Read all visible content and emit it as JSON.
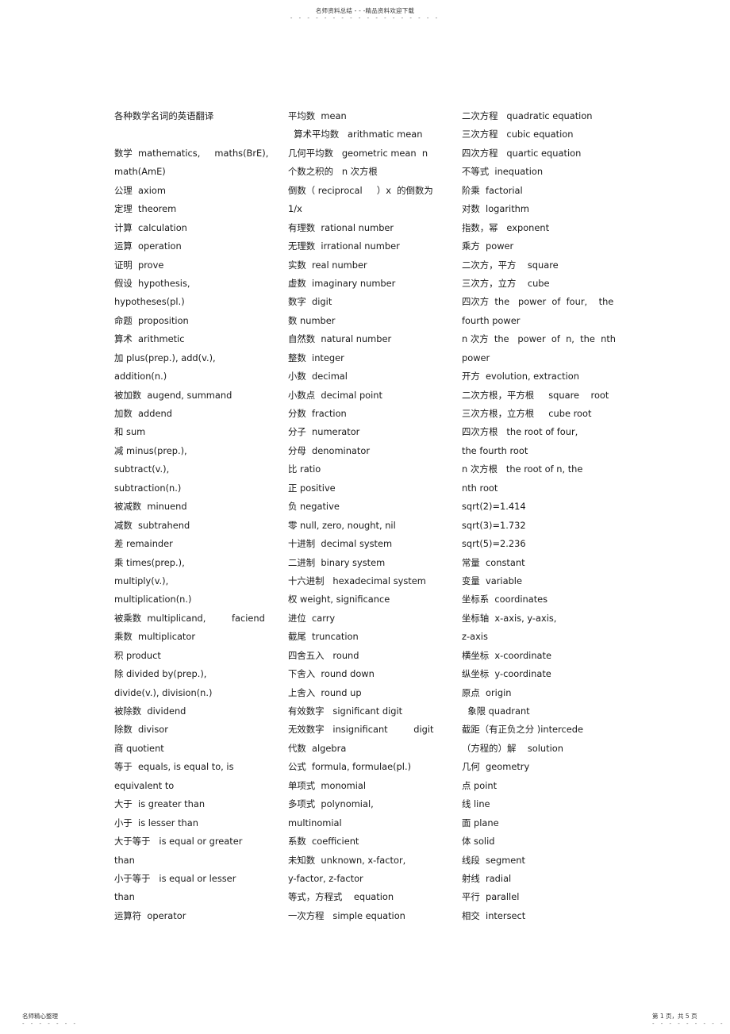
{
  "header": {
    "text": "名师资料总结 - - -精品资料欢迎下载",
    "dots": "- - - - - - - - - - - - - - - - - -"
  },
  "footer": {
    "left": "名师精心整理",
    "left_dots": "- - - - - - -",
    "right": "第 1 页，共 5 页",
    "right_dots": "- - - - - - - - -"
  },
  "columns": [
    {
      "lines": [
        "各种数学名词的英语翻译",
        "",
        "数学  mathematics,     maths(BrE),",
        "math(AmE)",
        "公理  axiom",
        "定理  theorem",
        "计算  calculation",
        "运算  operation",
        "证明  prove",
        "假设  hypothesis,",
        "hypotheses(pl.)",
        "命题  proposition",
        "算术  arithmetic",
        "加 plus(prep.), add(v.),",
        "addition(n.)",
        "被加数  augend, summand",
        "加数  addend",
        "和 sum",
        "减 minus(prep.),",
        "subtract(v.),",
        "subtraction(n.)",
        "被减数  minuend",
        "减数  subtrahend",
        "差 remainder",
        "乘 times(prep.),",
        "multiply(v.),",
        "multiplication(n.)",
        "被乘数  multiplicand,         faciend",
        "乘数  multiplicator",
        "积 product",
        "除 divided by(prep.),",
        "divide(v.), division(n.)",
        "被除数  dividend",
        "除数  divisor",
        "商 quotient",
        "等于  equals, is equal to, is",
        "equivalent to",
        "大于  is greater than",
        "小于  is lesser than",
        "大于等于   is equal or greater",
        "than",
        "小于等于   is equal or lesser",
        "than",
        "运算符  operator"
      ]
    },
    {
      "lines": [
        "平均数  mean",
        "  算术平均数   arithmatic mean",
        "几何平均数   geometric mean  n",
        "个数之积的   n 次方根",
        "倒数（ reciprocal     ）x  的倒数为",
        "1/x",
        "有理数  rational number",
        "无理数  irrational number",
        "实数  real number",
        "虚数  imaginary number",
        "数字  digit",
        "数 number",
        "自然数  natural number",
        "整数  integer",
        "小数  decimal",
        "小数点  decimal point",
        "分数  fraction",
        "分子  numerator",
        "分母  denominator",
        "比 ratio",
        "正 positive",
        "负 negative",
        "零 null, zero, nought, nil",
        "十进制  decimal system",
        "二进制  binary system",
        "十六进制   hexadecimal system",
        "权 weight, significance",
        "进位  carry",
        "截尾  truncation",
        "四舍五入   round",
        "下舍入  round down",
        "上舍入  round up",
        "有效数字   significant digit",
        "无效数字   insignificant         digit",
        "代数  algebra",
        "公式  formula, formulae(pl.)",
        "单项式  monomial",
        "多项式  polynomial,",
        "multinomial",
        "系数  coefficient",
        "未知数  unknown, x-factor,",
        "y-factor, z-factor",
        "等式，方程式    equation",
        "一次方程   simple equation"
      ]
    },
    {
      "lines": [
        "二次方程   quadratic equation",
        "三次方程   cubic equation",
        "四次方程   quartic equation",
        "不等式  inequation",
        "阶乘  factorial",
        "对数  logarithm",
        "指数，幂   exponent",
        "乘方  power",
        "二次方，平方    square",
        "三次方，立方    cube",
        "四次方  the   power  of  four,    the",
        "fourth power",
        "n 次方  the   power  of  n,  the  nth",
        "power",
        "开方  evolution, extraction",
        "二次方根，平方根     square    root",
        "三次方根，立方根     cube root",
        "四次方根   the root of four,",
        "the fourth root",
        "n 次方根   the root of n, the",
        "nth root",
        "sqrt(2)=1.414",
        "sqrt(3)=1.732",
        "sqrt(5)=2.236",
        "常量  constant",
        "变量  variable",
        "坐标系  coordinates",
        "坐标轴  x-axis, y-axis,",
        "z-axis",
        "横坐标  x-coordinate",
        "纵坐标  y-coordinate",
        "原点  origin",
        "  象限 quadrant",
        "截距（有正负之分 )intercede",
        "（方程的）解    solution",
        "几何  geometry",
        "点 point",
        "线 line",
        "面 plane",
        "体 solid",
        "线段  segment",
        "射线  radial",
        "平行  parallel",
        "相交  intersect"
      ]
    }
  ]
}
